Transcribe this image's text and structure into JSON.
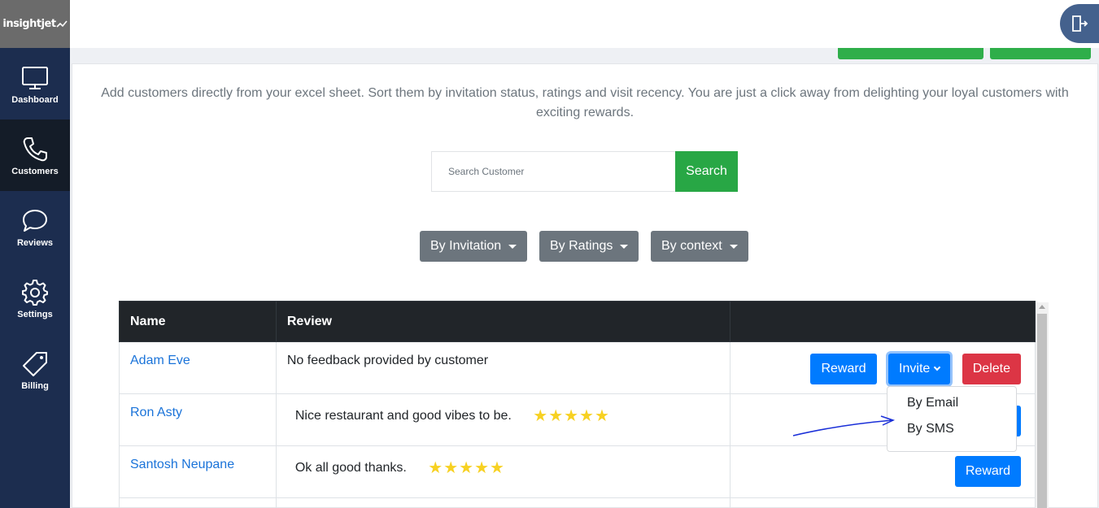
{
  "brand": {
    "name": "insightjet"
  },
  "sidebar": {
    "items": [
      {
        "label": "Dashboard",
        "icon": "monitor-icon",
        "active": false
      },
      {
        "label": "Customers",
        "icon": "phone-icon",
        "active": true
      },
      {
        "label": "Reviews",
        "icon": "chat-bubble-icon",
        "active": false
      },
      {
        "label": "Settings",
        "icon": "gear-icon",
        "active": false
      },
      {
        "label": "Billing",
        "icon": "tag-icon",
        "active": false
      }
    ]
  },
  "header": {
    "logout_icon": "logout-icon"
  },
  "main": {
    "intro": "Add customers directly from your excel sheet. Sort them by invitation status, ratings and visit recency. You are just a click away from delighting your loyal customers with exciting rewards.",
    "search": {
      "placeholder": "Search Customer",
      "button_label": "Search"
    },
    "filters": [
      {
        "label": "By Invitation"
      },
      {
        "label": "By Ratings"
      },
      {
        "label": "By context"
      }
    ]
  },
  "table": {
    "headers": [
      "Name",
      "Review",
      ""
    ],
    "rows": [
      {
        "name": "Adam Eve",
        "review": "No feedback provided by customer",
        "stars": 0
      },
      {
        "name": "Ron Asty",
        "review": "Nice restaurant and good vibes to be.",
        "stars": 5
      },
      {
        "name": "Santosh Neupane",
        "review": "Ok all good thanks.",
        "stars": 5
      }
    ],
    "actions": {
      "reward": "Reward",
      "invite": "Invite",
      "delete": "Delete"
    }
  },
  "invite_dropdown": {
    "options": [
      "By Email",
      "By SMS"
    ]
  },
  "colors": {
    "sidebar": "#1c2d4f",
    "sidebar_active": "#141c28",
    "primary": "#007bff",
    "success": "#28a745",
    "danger": "#dc3545",
    "secondary": "#6c757d",
    "star": "#f7d122"
  }
}
